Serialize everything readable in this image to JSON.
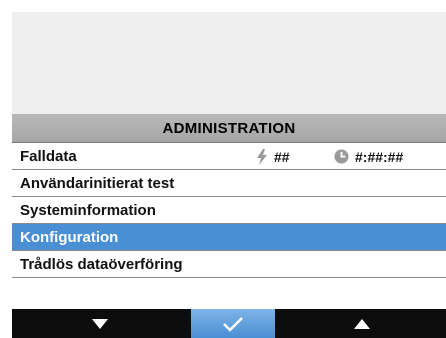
{
  "menu": {
    "title": "ADMINISTRATION",
    "items": [
      {
        "label": "Falldata",
        "events_value": "##",
        "time_value": "#:##:##"
      },
      {
        "label": "Användarinitierat test"
      },
      {
        "label": "Systeminformation"
      },
      {
        "label": "Konfiguration",
        "selected": true
      },
      {
        "label": "Trådlös dataöverföring"
      }
    ]
  },
  "softkeys": {
    "left_icon": "down-arrow-icon",
    "middle_icon": "checkmark-icon",
    "right_icon": "up-arrow-icon"
  },
  "colors": {
    "selection": "#4a8fd3",
    "header": "#aaaaaa",
    "softkey_bar": "#0d0d0d"
  }
}
